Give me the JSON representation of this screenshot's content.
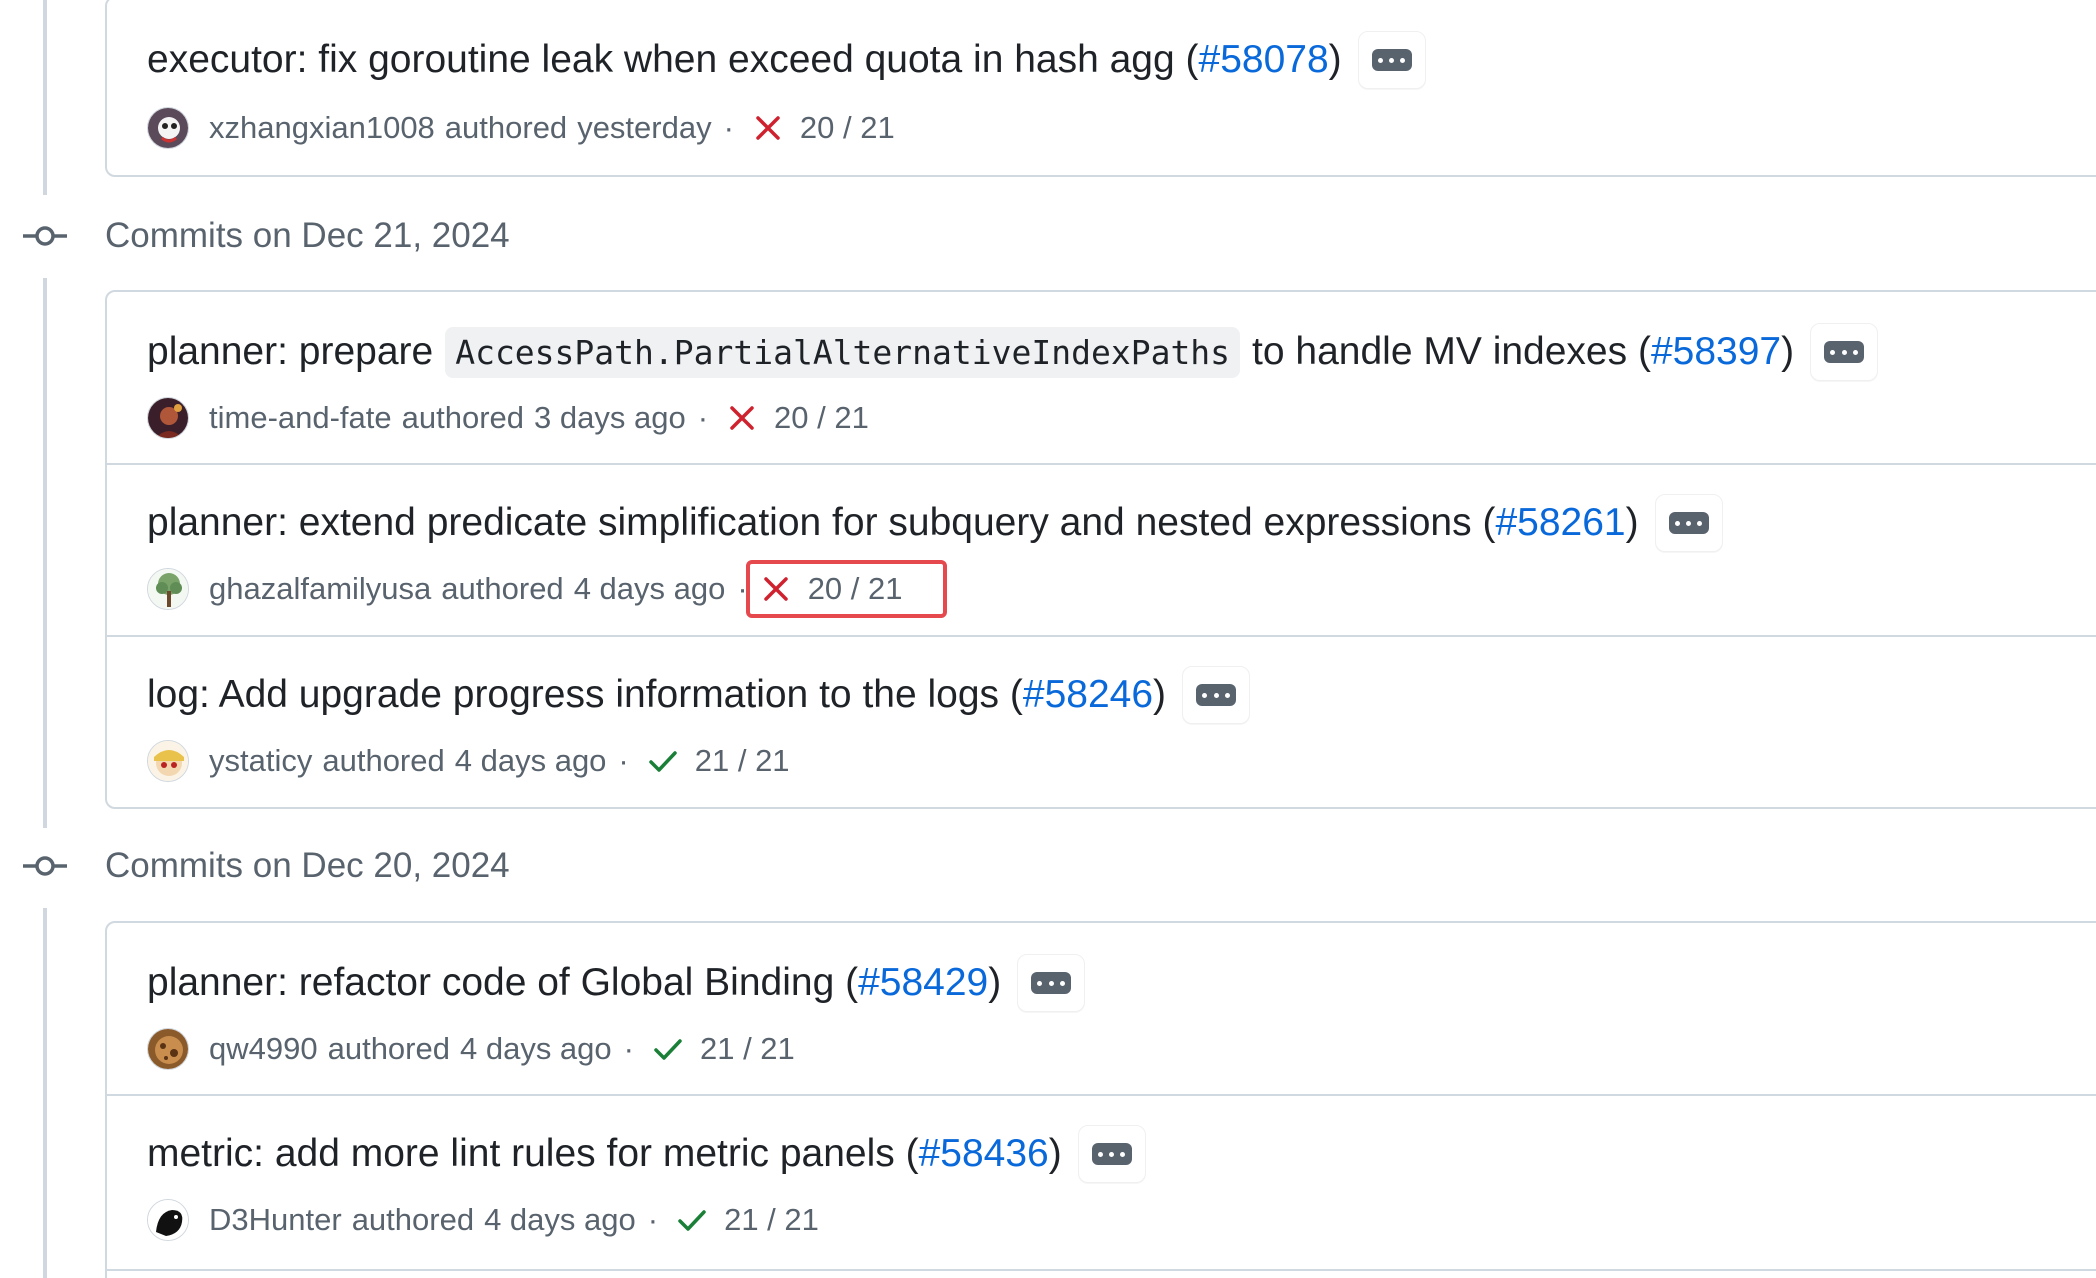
{
  "groups": [
    {
      "header": "",
      "commits": [
        {
          "title_pre": "executor: fix goroutine leak when exceed quota in hash agg (",
          "code": "",
          "title_post": "",
          "pr": "#58078",
          "close": ")",
          "author": "xzhangxian1008",
          "authored": "authored",
          "when": "yesterday",
          "separator": "·",
          "status": "fail",
          "checks": "20 / 21"
        }
      ]
    },
    {
      "header": "Commits on Dec 21, 2024",
      "commits": [
        {
          "title_pre": "planner: prepare",
          "code": "AccessPath.PartialAlternativeIndexPaths",
          "title_post": "to handle MV indexes (",
          "pr": "#58397",
          "close": ")",
          "author": "time-and-fate",
          "authored": "authored",
          "when": "3 days ago",
          "separator": "·",
          "status": "fail",
          "checks": "20 / 21"
        },
        {
          "title_pre": "planner: extend predicate simplification for subquery and nested expressions (",
          "code": "",
          "title_post": "",
          "pr": "#58261",
          "close": ")",
          "author": "ghazalfamilyusa",
          "authored": "authored",
          "when": "4 days ago",
          "separator": "·",
          "status": "fail",
          "checks": "20 / 21",
          "highlight": true
        },
        {
          "title_pre": "log: Add upgrade progress information to the logs (",
          "code": "",
          "title_post": "",
          "pr": "#58246",
          "close": ")",
          "author": "ystaticy",
          "authored": "authored",
          "when": "4 days ago",
          "separator": "·",
          "status": "pass",
          "checks": "21 / 21"
        }
      ]
    },
    {
      "header": "Commits on Dec 20, 2024",
      "commits": [
        {
          "title_pre": "planner: refactor code of Global Binding (",
          "code": "",
          "title_post": "",
          "pr": "#58429",
          "close": ")",
          "author": "qw4990",
          "authored": "authored",
          "when": "4 days ago",
          "separator": "·",
          "status": "pass",
          "checks": "21 / 21"
        },
        {
          "title_pre": "metric: add more lint rules for metric panels (",
          "code": "",
          "title_post": "",
          "pr": "#58436",
          "close": ")",
          "author": "D3Hunter",
          "authored": "authored",
          "when": "4 days ago",
          "separator": "·",
          "status": "pass",
          "checks": "21 / 21"
        }
      ]
    }
  ],
  "colors": {
    "fail": "#cf222e",
    "pass": "#1a7f37",
    "link": "#0969da",
    "muted": "#59636e",
    "highlight": "#e5484d"
  }
}
